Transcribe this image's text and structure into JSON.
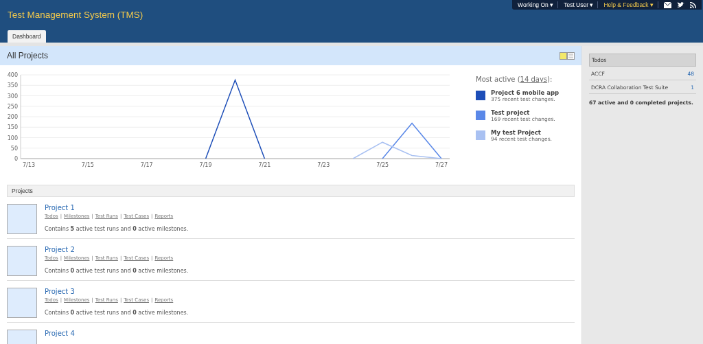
{
  "header": {
    "title": "Test Management System (TMS)",
    "menu": [
      {
        "label": "Working On",
        "caret": "▾",
        "kind": "menu"
      },
      {
        "label": "Test User",
        "caret": "▾",
        "kind": "menu"
      },
      {
        "label": "Help & Feedback",
        "caret": "▾",
        "kind": "help"
      }
    ]
  },
  "tabs": [
    {
      "label": "Dashboard",
      "selected": true
    }
  ],
  "main": {
    "title": "All Projects",
    "chart_data": {
      "type": "line",
      "grid": true,
      "categories": [
        "7/13",
        null,
        "7/15",
        null,
        "7/17",
        null,
        "7/19",
        null,
        "7/21",
        null,
        "7/23",
        null,
        "7/25",
        null,
        "7/27"
      ],
      "ylim": [
        0,
        400
      ],
      "yticks": [
        0,
        50,
        100,
        150,
        200,
        250,
        300,
        350,
        400
      ],
      "series": [
        {
          "name": "Project 6 mobile app",
          "color": "#1d4eb8",
          "values": [
            null,
            null,
            null,
            null,
            null,
            null,
            0,
            375,
            0,
            null,
            null,
            null,
            null,
            null,
            null
          ]
        },
        {
          "name": "Test project",
          "color": "#5a88e8",
          "values": [
            null,
            null,
            null,
            null,
            null,
            null,
            null,
            null,
            null,
            null,
            null,
            null,
            0,
            169,
            0
          ]
        },
        {
          "name": "My test Project",
          "color": "#a9c1f2",
          "values": [
            null,
            null,
            null,
            null,
            null,
            null,
            null,
            null,
            null,
            null,
            null,
            0,
            78,
            15,
            0
          ]
        }
      ]
    },
    "most_active": {
      "label": "Most active (",
      "link": "14 days",
      "suffix": "):",
      "items": [
        {
          "changes": "375 recent test changes."
        },
        {
          "changes": "169 recent test changes."
        },
        {
          "changes": "94 recent test changes."
        }
      ]
    },
    "projects_heading": "Projects",
    "projects": [
      {
        "name": "Project 1",
        "links": [
          "Todos",
          "Milestones",
          "Test Runs",
          "Test Cases",
          "Reports"
        ],
        "separator": "|",
        "summary": "Contains **5** active test runs and **0** active milestones."
      },
      {
        "name": "Project 2",
        "links": [
          "Todos",
          "Milestones",
          "Test Runs",
          "Test Cases",
          "Reports"
        ],
        "separator": "|",
        "summary": "Contains **0** active test runs and **0** active milestones."
      },
      {
        "name": "Project 3",
        "links": [
          "Todos",
          "Milestones",
          "Test Runs",
          "Test Cases",
          "Reports"
        ],
        "separator": "|",
        "summary": "Contains **0** active test runs and **0** active milestones."
      },
      {
        "name": "Project 4"
      }
    ]
  },
  "sidebar": {
    "title": "Todos",
    "items": [
      {
        "name": "ACCF",
        "count": "48"
      },
      {
        "name": "DCRA Collaboration Test Suite",
        "count": "1"
      }
    ],
    "summary": "67 active and 0 completed projects."
  }
}
